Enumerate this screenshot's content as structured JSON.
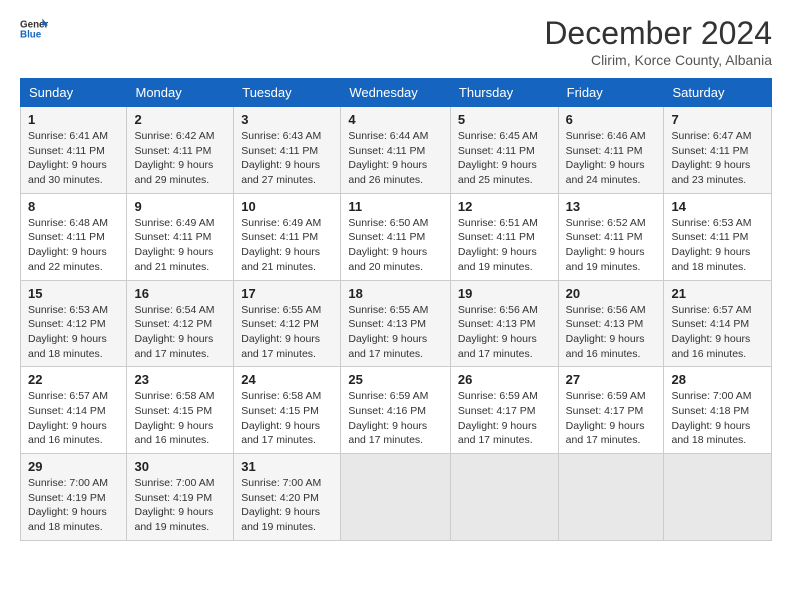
{
  "header": {
    "logo_general": "General",
    "logo_blue": "Blue",
    "title": "December 2024",
    "subtitle": "Clirim, Korce County, Albania"
  },
  "weekdays": [
    "Sunday",
    "Monday",
    "Tuesday",
    "Wednesday",
    "Thursday",
    "Friday",
    "Saturday"
  ],
  "weeks": [
    [
      {
        "day": "1",
        "sunrise": "6:41 AM",
        "sunset": "4:11 PM",
        "daylight": "9 hours and 30 minutes."
      },
      {
        "day": "2",
        "sunrise": "6:42 AM",
        "sunset": "4:11 PM",
        "daylight": "9 hours and 29 minutes."
      },
      {
        "day": "3",
        "sunrise": "6:43 AM",
        "sunset": "4:11 PM",
        "daylight": "9 hours and 27 minutes."
      },
      {
        "day": "4",
        "sunrise": "6:44 AM",
        "sunset": "4:11 PM",
        "daylight": "9 hours and 26 minutes."
      },
      {
        "day": "5",
        "sunrise": "6:45 AM",
        "sunset": "4:11 PM",
        "daylight": "9 hours and 25 minutes."
      },
      {
        "day": "6",
        "sunrise": "6:46 AM",
        "sunset": "4:11 PM",
        "daylight": "9 hours and 24 minutes."
      },
      {
        "day": "7",
        "sunrise": "6:47 AM",
        "sunset": "4:11 PM",
        "daylight": "9 hours and 23 minutes."
      }
    ],
    [
      {
        "day": "8",
        "sunrise": "6:48 AM",
        "sunset": "4:11 PM",
        "daylight": "9 hours and 22 minutes."
      },
      {
        "day": "9",
        "sunrise": "6:49 AM",
        "sunset": "4:11 PM",
        "daylight": "9 hours and 21 minutes."
      },
      {
        "day": "10",
        "sunrise": "6:49 AM",
        "sunset": "4:11 PM",
        "daylight": "9 hours and 21 minutes."
      },
      {
        "day": "11",
        "sunrise": "6:50 AM",
        "sunset": "4:11 PM",
        "daylight": "9 hours and 20 minutes."
      },
      {
        "day": "12",
        "sunrise": "6:51 AM",
        "sunset": "4:11 PM",
        "daylight": "9 hours and 19 minutes."
      },
      {
        "day": "13",
        "sunrise": "6:52 AM",
        "sunset": "4:11 PM",
        "daylight": "9 hours and 19 minutes."
      },
      {
        "day": "14",
        "sunrise": "6:53 AM",
        "sunset": "4:11 PM",
        "daylight": "9 hours and 18 minutes."
      }
    ],
    [
      {
        "day": "15",
        "sunrise": "6:53 AM",
        "sunset": "4:12 PM",
        "daylight": "9 hours and 18 minutes."
      },
      {
        "day": "16",
        "sunrise": "6:54 AM",
        "sunset": "4:12 PM",
        "daylight": "9 hours and 17 minutes."
      },
      {
        "day": "17",
        "sunrise": "6:55 AM",
        "sunset": "4:12 PM",
        "daylight": "9 hours and 17 minutes."
      },
      {
        "day": "18",
        "sunrise": "6:55 AM",
        "sunset": "4:13 PM",
        "daylight": "9 hours and 17 minutes."
      },
      {
        "day": "19",
        "sunrise": "6:56 AM",
        "sunset": "4:13 PM",
        "daylight": "9 hours and 17 minutes."
      },
      {
        "day": "20",
        "sunrise": "6:56 AM",
        "sunset": "4:13 PM",
        "daylight": "9 hours and 16 minutes."
      },
      {
        "day": "21",
        "sunrise": "6:57 AM",
        "sunset": "4:14 PM",
        "daylight": "9 hours and 16 minutes."
      }
    ],
    [
      {
        "day": "22",
        "sunrise": "6:57 AM",
        "sunset": "4:14 PM",
        "daylight": "9 hours and 16 minutes."
      },
      {
        "day": "23",
        "sunrise": "6:58 AM",
        "sunset": "4:15 PM",
        "daylight": "9 hours and 16 minutes."
      },
      {
        "day": "24",
        "sunrise": "6:58 AM",
        "sunset": "4:15 PM",
        "daylight": "9 hours and 17 minutes."
      },
      {
        "day": "25",
        "sunrise": "6:59 AM",
        "sunset": "4:16 PM",
        "daylight": "9 hours and 17 minutes."
      },
      {
        "day": "26",
        "sunrise": "6:59 AM",
        "sunset": "4:17 PM",
        "daylight": "9 hours and 17 minutes."
      },
      {
        "day": "27",
        "sunrise": "6:59 AM",
        "sunset": "4:17 PM",
        "daylight": "9 hours and 17 minutes."
      },
      {
        "day": "28",
        "sunrise": "7:00 AM",
        "sunset": "4:18 PM",
        "daylight": "9 hours and 18 minutes."
      }
    ],
    [
      {
        "day": "29",
        "sunrise": "7:00 AM",
        "sunset": "4:19 PM",
        "daylight": "9 hours and 18 minutes."
      },
      {
        "day": "30",
        "sunrise": "7:00 AM",
        "sunset": "4:19 PM",
        "daylight": "9 hours and 19 minutes."
      },
      {
        "day": "31",
        "sunrise": "7:00 AM",
        "sunset": "4:20 PM",
        "daylight": "9 hours and 19 minutes."
      },
      null,
      null,
      null,
      null
    ]
  ],
  "labels": {
    "sunrise": "Sunrise:",
    "sunset": "Sunset:",
    "daylight": "Daylight:"
  }
}
